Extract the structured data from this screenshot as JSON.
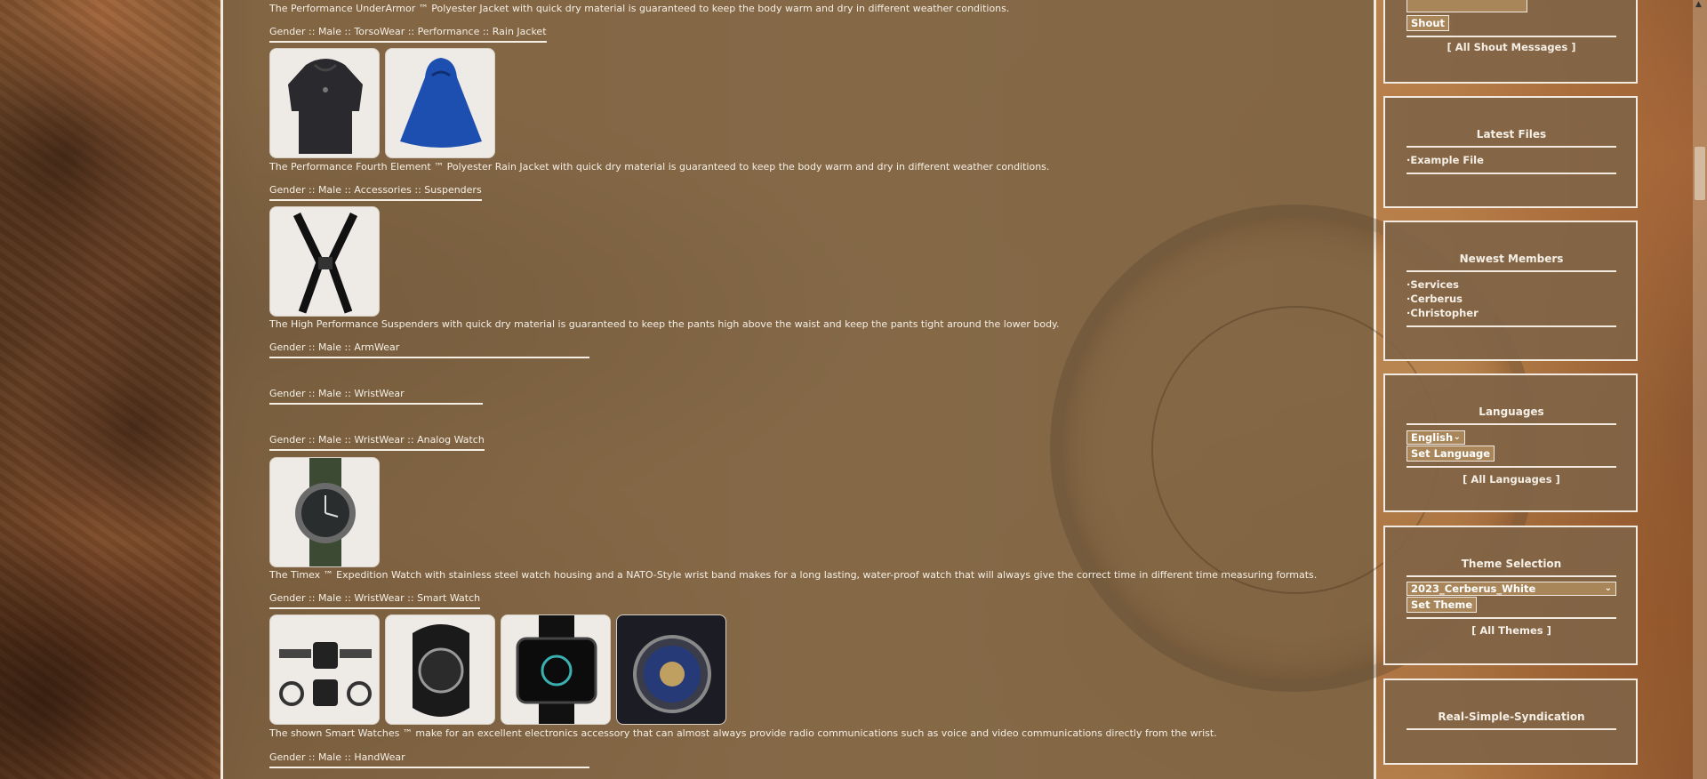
{
  "products": {
    "p1_desc": "The Performance UnderArmor ™ Polyester Jacket with quick dry material is guaranteed to keep the body warm and dry in different weather conditions.",
    "c1": "Gender :: Male :: TorsoWear :: Performance :: Rain Jacket",
    "p2_desc": "The Performance Fourth Element ™ Polyester Rain Jacket with quick dry material is guaranteed to keep the body warm and dry in different weather conditions.",
    "c2": "Gender :: Male :: Accessories :: Suspenders",
    "p3_desc": "The High Performance Suspenders with quick dry material is guaranteed to keep the pants high above the waist and keep the pants tight around the lower body.",
    "c3": "Gender :: Male :: ArmWear",
    "c4": "Gender :: Male :: WristWear",
    "c5": "Gender :: Male :: WristWear :: Analog Watch",
    "p4_desc": "The Timex ™ Expedition Watch with stainless steel watch housing and a NATO-Style wrist band makes for a long lasting, water-proof watch that will always give the correct time in different time measuring formats.",
    "c6": "Gender :: Male :: WristWear :: Smart Watch",
    "p5_desc": "The shown Smart Watches ™ make for an excellent electronics accessory that can almost always provide radio communications such as voice and video communications directly from the wrist.",
    "c7": "Gender :: Male :: HandWear"
  },
  "shoutbox": {
    "button": "Shout",
    "all_link": "[ All Shout Messages ]"
  },
  "latest_files": {
    "title": "Latest Files",
    "items": [
      "Example File"
    ]
  },
  "newest_members": {
    "title": "Newest Members",
    "items": [
      "Services",
      "Cerberus",
      "Christopher"
    ]
  },
  "languages": {
    "title": "Languages",
    "selected": "English",
    "button": "Set Language",
    "all_link": "[ All Languages ]"
  },
  "themes": {
    "title": "Theme Selection",
    "selected": "2023_Cerberus_White",
    "button": "Set Theme",
    "all_link": "[ All Themes ]"
  },
  "rss": {
    "title": "Real-Simple-Syndication"
  },
  "icons": {
    "scroll_up": "scroll-up-arrow-icon"
  }
}
